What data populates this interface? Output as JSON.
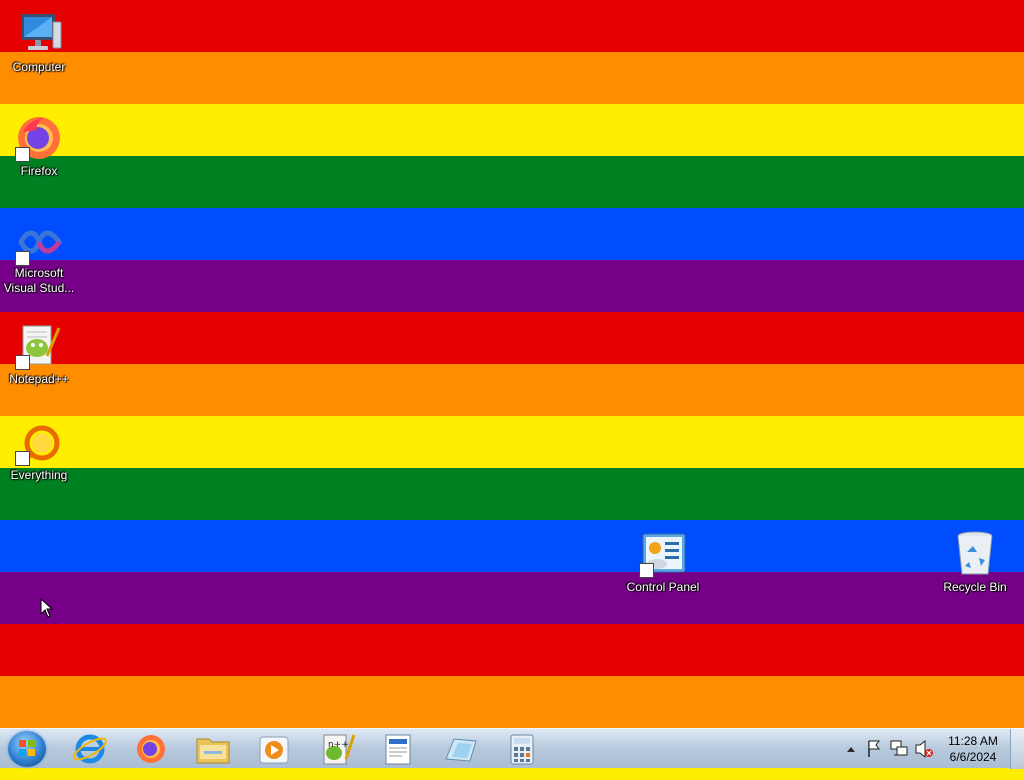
{
  "wallpaper": {
    "stripes": [
      "#e50000",
      "#ff8d00",
      "#ffee00",
      "#008121",
      "#004cff",
      "#760188",
      "#e50000",
      "#ff8d00",
      "#ffee00",
      "#008121",
      "#004cff",
      "#760188",
      "#e50000",
      "#ff8d00",
      "#ffee00"
    ]
  },
  "desktop": {
    "icons": {
      "computer": {
        "label": "Computer",
        "icon": "computer-icon"
      },
      "firefox": {
        "label": "Firefox",
        "icon": "firefox-icon"
      },
      "visual_studio": {
        "label_line1": "Microsoft",
        "label_line2": "Visual Stud...",
        "icon": "visual-studio-icon"
      },
      "notepadpp": {
        "label": "Notepad++",
        "icon": "notepad-plus-plus-icon"
      },
      "everything": {
        "label": "Everything",
        "icon": "everything-search-icon"
      },
      "control_panel": {
        "label": "Control Panel",
        "icon": "control-panel-icon"
      },
      "recycle_bin": {
        "label": "Recycle Bin",
        "icon": "recycle-bin-icon"
      }
    }
  },
  "taskbar": {
    "pinned": [
      "internet-explorer-icon",
      "firefox-icon",
      "file-explorer-icon",
      "media-player-icon",
      "notepad-plus-plus-icon",
      "wordpad-icon",
      "paint-icon",
      "calculator-icon"
    ],
    "tray": [
      "show-hidden-icons-icon",
      "action-center-flag-icon",
      "network-icon",
      "volume-muted-icon"
    ],
    "clock": {
      "time": "11:28 AM",
      "date": "6/6/2024"
    }
  },
  "colors": {
    "taskbar": "#b7c9dc",
    "label_text": "#ffffff"
  }
}
